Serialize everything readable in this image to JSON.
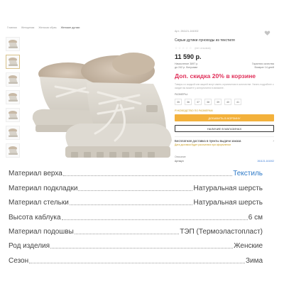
{
  "breadcrumb": [
    "Главная",
    "Женщинам",
    "Женская обувь",
    "Женские дутики"
  ],
  "thumbnails": [
    {
      "icon": "boot-thumbnail-icon",
      "active": false
    },
    {
      "icon": "boot-thumbnail-icon",
      "active": true
    },
    {
      "icon": "boot-thumbnail-icon",
      "active": false
    },
    {
      "icon": "boot-thumbnail-icon",
      "active": false
    },
    {
      "icon": "boot-thumbnail-icon",
      "active": false
    },
    {
      "icon": "boot-thumbnail-icon",
      "active": false
    },
    {
      "icon": "boot-thumbnail-icon",
      "active": false
    }
  ],
  "product": {
    "sku": "Арт.: 261121-161002",
    "title": "Серые дутики луноходы из текстиля",
    "rating_count": "(нет отзывов)",
    "price": "11 590 р.",
    "bonus_left": "Начисление 3897 р.",
    "bonus_left_sub": "до 242 р. бонусами",
    "bonus_right": "Гарантия качества",
    "bonus_right_sub": "Возврат 14 дней",
    "promo": "Доп. скидка 20% в корзине",
    "note": "Товары со скидкой или акцией могут иметь ограничения в количестве. Узнать подробнее о скидке вы можете у консультанта в магазине.",
    "size_label": "РАЗМЕРЫ:",
    "sizes": [
      "35",
      "36",
      "37",
      "38",
      "39",
      "40",
      "41"
    ],
    "size_guide": "РУКОВОДСТВО ПО РАЗМЕРАМ",
    "cart_button": "ДОБАВИТЬ В КОРЗИНУ",
    "store_button": "НАЛИЧИЕ В МАГАЗИНАХ",
    "delivery_title": "Бесплатная доставка в пункты выдачи заказа",
    "delivery_sub": "Дата доставки будет рассчитана при оформлении",
    "description_label": "Описание",
    "description_row_key": "Артикул",
    "description_row_val": "261121-161002"
  },
  "specs": [
    {
      "key": "Материал верха",
      "value": "Текстиль",
      "link": true
    },
    {
      "key": "Материал подкладки",
      "value": "Натуральная шерсть",
      "link": false
    },
    {
      "key": "Материал стельки",
      "value": "Натуральная шерсть",
      "link": false
    },
    {
      "key": "Высота каблука",
      "value": "6 см",
      "link": false
    },
    {
      "key": "Материал подошвы",
      "value": "ТЭП (Термоэластопласт)",
      "link": false
    },
    {
      "key": "Род изделия",
      "value": "Женские",
      "link": false
    },
    {
      "key": "Сезон",
      "value": "Зима",
      "link": false
    }
  ],
  "colors": {
    "accent_gold": "#c89a1a",
    "promo_pink": "#e0305a",
    "cart_orange": "#f3b13b",
    "link_blue": "#2d79c7"
  }
}
